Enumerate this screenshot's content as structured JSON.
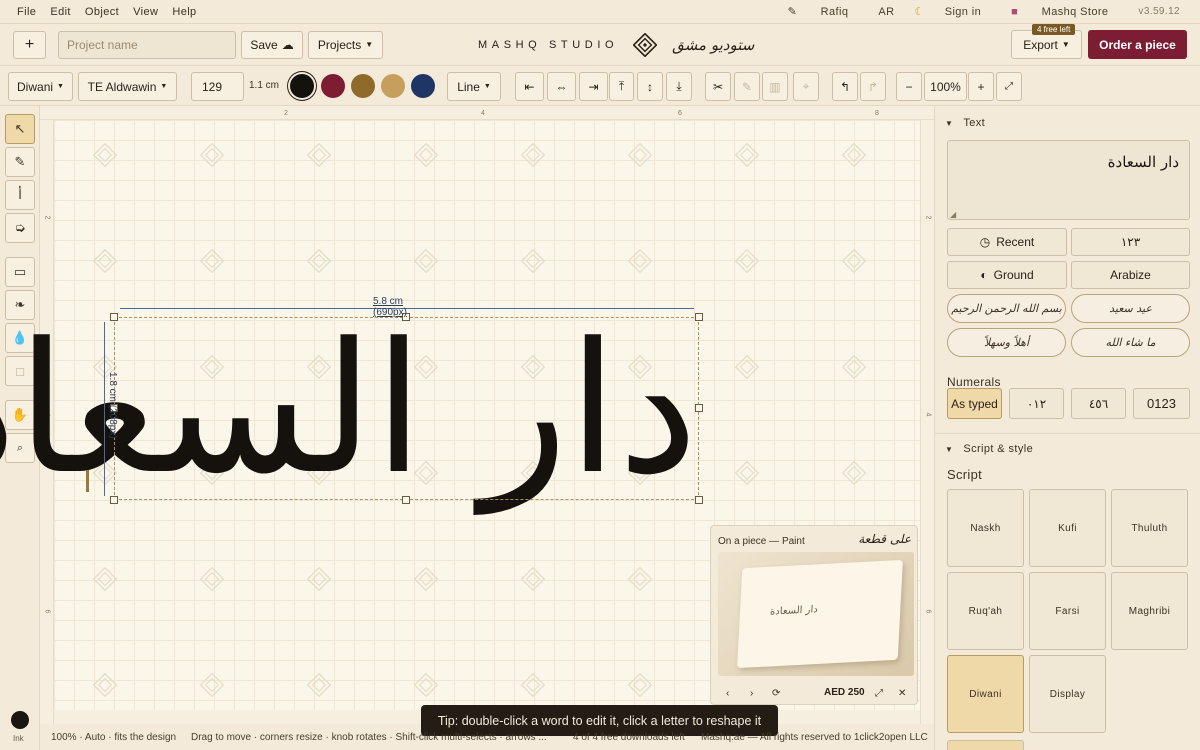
{
  "menu": {
    "items": [
      "File",
      "Edit",
      "Object",
      "View",
      "Help"
    ]
  },
  "menu_right": {
    "user": "Rafiq",
    "lang": "AR",
    "theme_icon": "moon-icon",
    "signin": "Sign in",
    "store": "Mashq Store",
    "version": "v3.59.12"
  },
  "header": {
    "add_label": "+",
    "project_placeholder": "Project name",
    "save_label": "Save",
    "projects_label": "Projects",
    "brand_name": "MASHQ STUDIO",
    "brand_ar": "ستوديو مشق",
    "export_label": "Export",
    "free_badge": "4 free left",
    "order_label": "Order a piece"
  },
  "toolbar": {
    "script_select": "Diwani",
    "font_select": "TE Aldwawin",
    "size_value": "129",
    "size_unit": "1.1 cm",
    "colors": [
      "#15110c",
      "#7d1d33",
      "#8f6a2a",
      "#c79f5c",
      "#1f3566"
    ],
    "line_select": "Line",
    "zoom_minus": "−",
    "zoom_value": "100%",
    "zoom_plus": "+"
  },
  "canvas": {
    "ruler_top": [
      "2",
      "4",
      "6",
      "8"
    ],
    "ruler_side": [
      "2",
      "4",
      "6"
    ],
    "calligraphy_text": "دار السعادة",
    "width_label": "5.8 cm (690px)",
    "height_label": "1.8 cm (208px)"
  },
  "preview": {
    "title": "On a piece",
    "medium": "Paint",
    "title_ar": "على قطعة",
    "card_text": "دار السعادة",
    "price": "AED 250"
  },
  "tip": "Tip: double-click a word to edit it, click a letter to reshape it",
  "status": {
    "zoom_info": "100% · Auto · fits the design",
    "hint": "Drag to move · corners resize · knob rotates · Shift-click multi-selects · arrows ...",
    "downloads": "4 of 4 free downloads left",
    "copyright": "Mashq.ae — All rights reserved to 1click2open LLC",
    "ink_label": "Ink"
  },
  "panel": {
    "text_section": "Text",
    "text_value": "دار السعادة",
    "recent_label": "Recent",
    "numerals_button": "١٢٣",
    "ground_label": "Ground",
    "arabize_label": "Arabize",
    "phrases": [
      "بسم الله الرحمن الرحيم",
      "عيد سعيد",
      "أهلاً وسهلاً",
      "ما شاء الله"
    ],
    "numerals_label": "Numerals",
    "numeral_options": [
      "As typed",
      "٠١٢",
      "٤٥٦",
      "0123"
    ],
    "script_section": "Script & style",
    "script_label": "Script",
    "scripts": [
      "Naskh",
      "Kufi",
      "Thuluth",
      "Ruq'ah",
      "Farsi",
      "Maghribi",
      "Diwani",
      "Display"
    ]
  }
}
